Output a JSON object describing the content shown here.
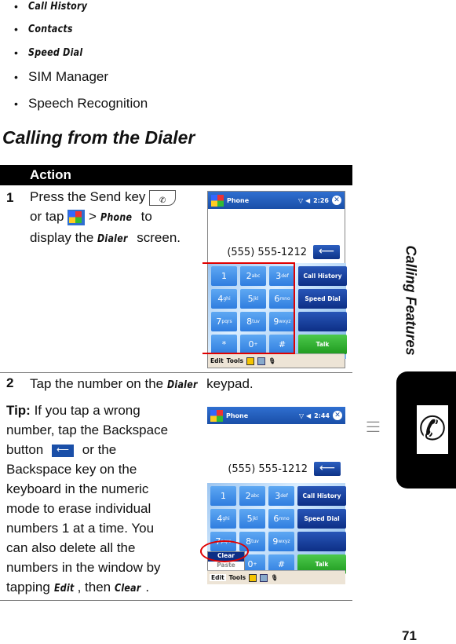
{
  "list": [
    "Call History",
    "Contacts",
    "Speed Dial",
    "SIM Manager",
    "Speech Recognition"
  ],
  "heading": "Calling from the Dialer",
  "table_header": "Action",
  "step1": {
    "num": "1",
    "line1": "Press the Send key",
    "line2a": "or tap",
    "line2b": ">",
    "phone": "Phone",
    "line2c": "to",
    "line3a": "display the",
    "dialer": "Dialer",
    "line3b": "screen."
  },
  "step2": {
    "num": "2",
    "a": "Tap the number on the",
    "dialer": "Dialer",
    "b": "keypad."
  },
  "tip": {
    "label": "Tip:",
    "l1": " If you tap a wrong",
    "l2": "number, tap the Backspace",
    "l3a": "button",
    "l3b": "or the",
    "l4": "Backspace key on the",
    "l5": "keyboard in the numeric",
    "l6": "mode to erase individual",
    "l7": "numbers 1 at a time. You",
    "l8": "can also delete all the",
    "l9": "numbers in the window by",
    "l10a": "tapping",
    "edit": "Edit",
    "l10b": ", then",
    "clear": "Clear",
    "l10c": "."
  },
  "screen1": {
    "title": "Phone",
    "time": "2:26",
    "number": "(555) 555-1212",
    "menu_edit": "Edit",
    "menu_tools": "Tools"
  },
  "screen2": {
    "title": "Phone",
    "time": "2:44",
    "number": "(555) 555-1212",
    "menu_edit": "Edit",
    "menu_tools": "Tools",
    "popup": [
      "Clear",
      "Paste"
    ]
  },
  "keys": [
    [
      "1",
      ""
    ],
    [
      "2",
      "abc"
    ],
    [
      "3",
      "def"
    ],
    [
      "4",
      "ghi"
    ],
    [
      "5",
      "jkl"
    ],
    [
      "6",
      "mno"
    ],
    [
      "7",
      "pqrs"
    ],
    [
      "8",
      "tuv"
    ],
    [
      "9",
      "wxyz"
    ],
    [
      "*",
      ""
    ],
    [
      "0",
      "+"
    ],
    [
      "#",
      ""
    ]
  ],
  "fkeys": [
    "Call History",
    "Speed Dial",
    "",
    "Talk"
  ],
  "side_label": "Calling Features",
  "page_number": "71",
  "colors": {
    "highlight": "#e00000"
  }
}
